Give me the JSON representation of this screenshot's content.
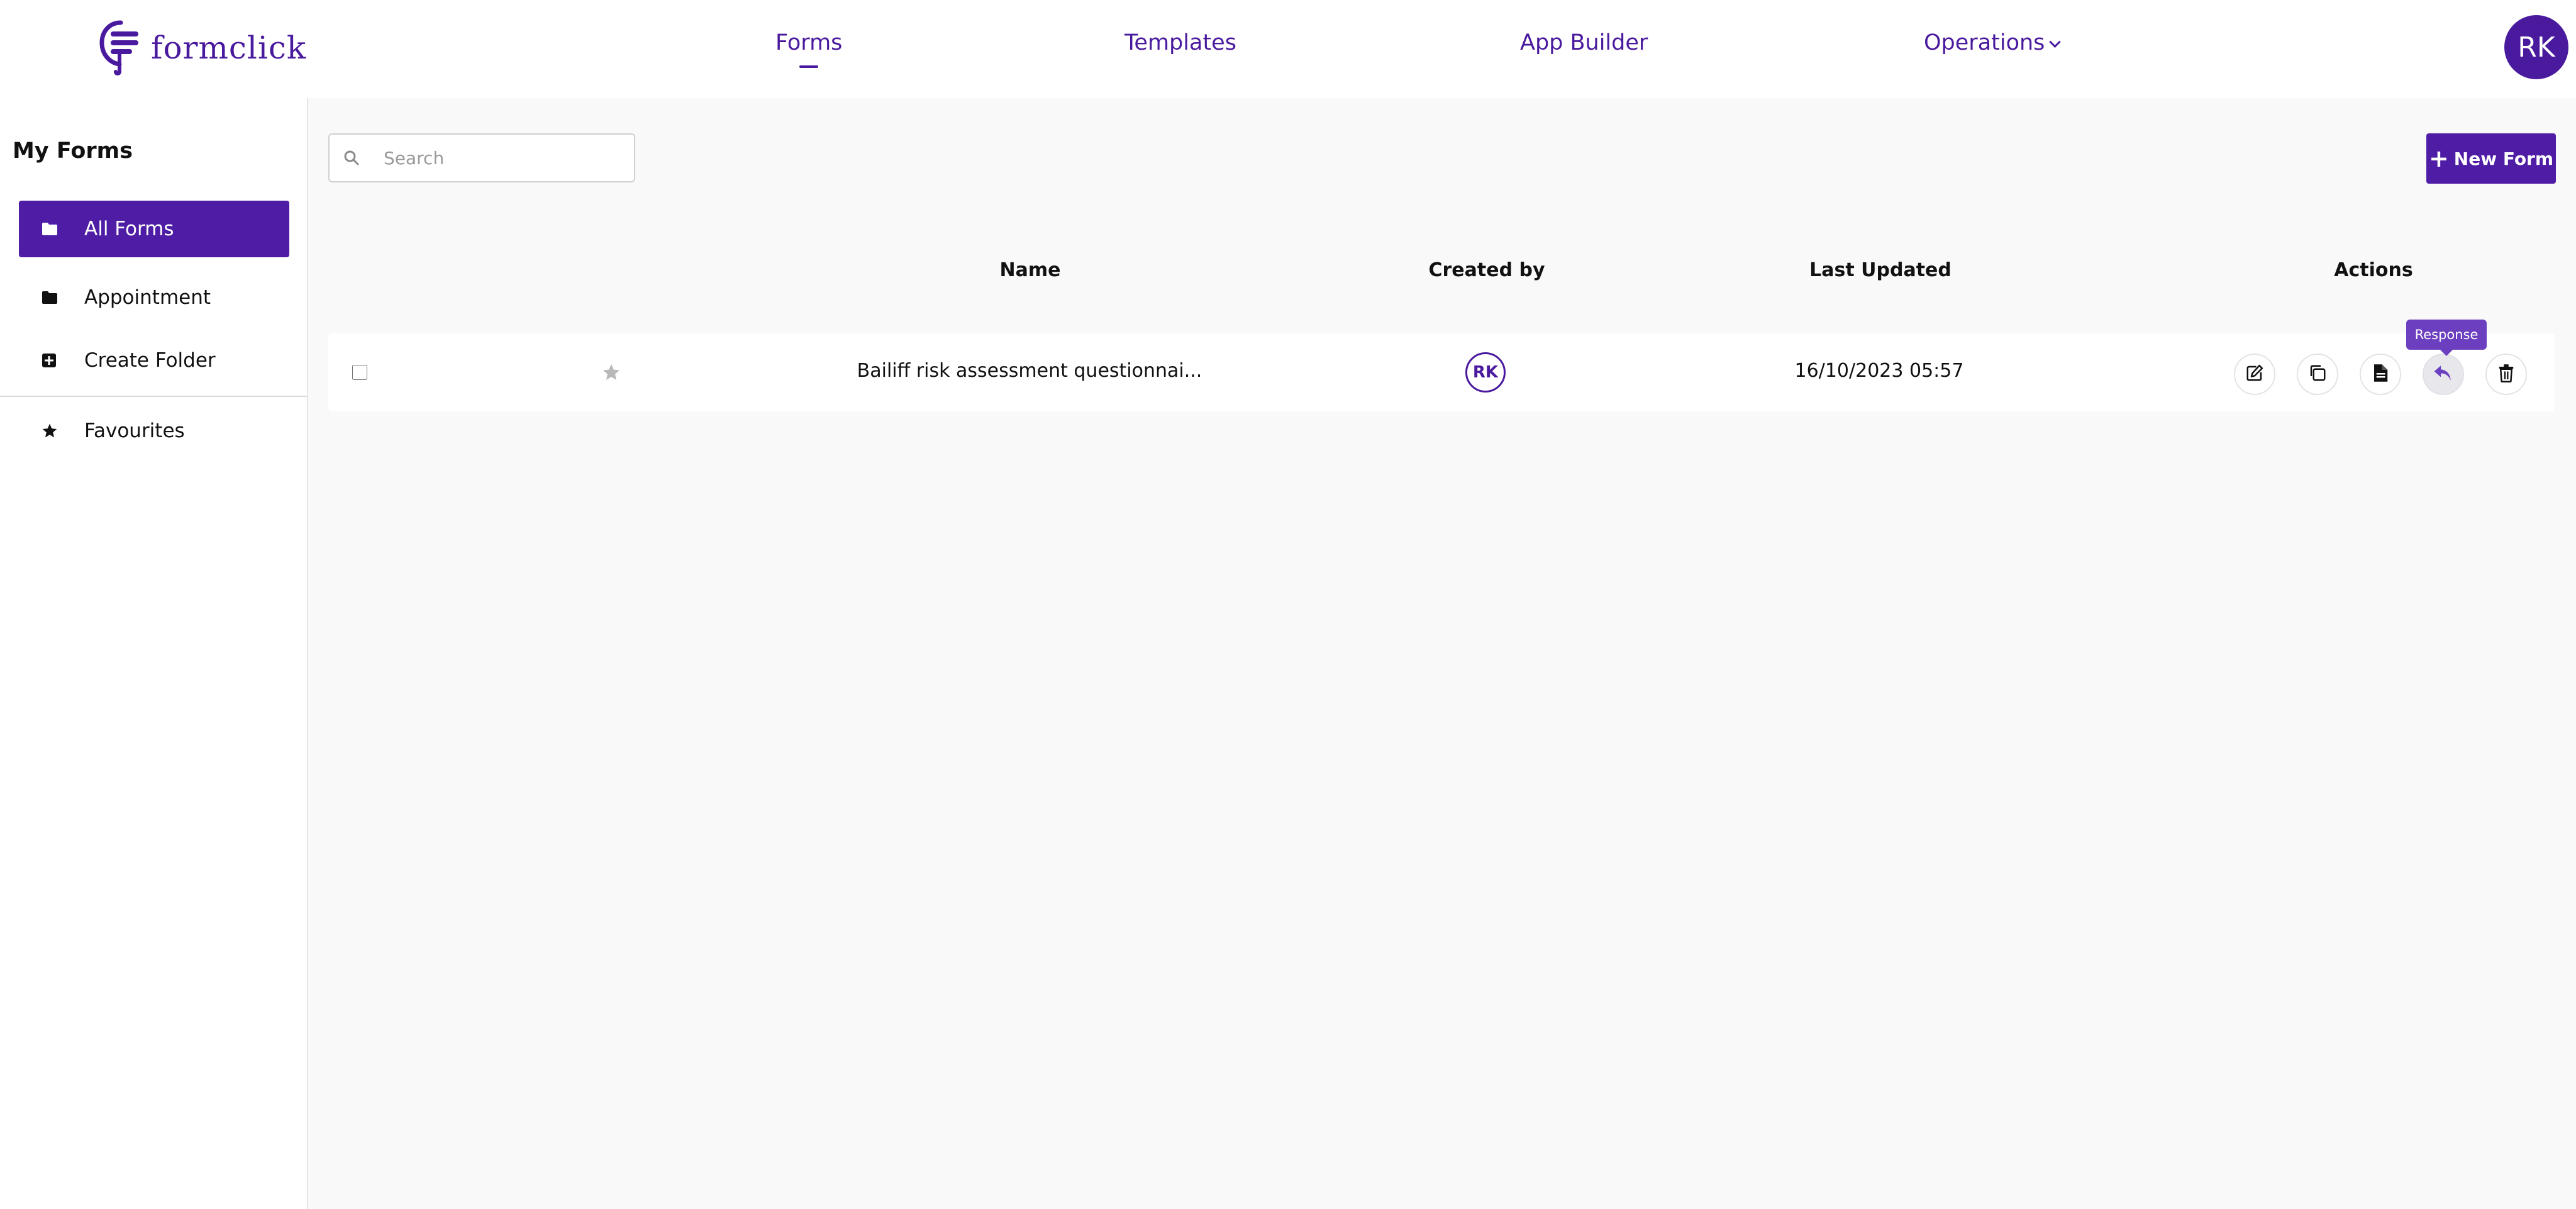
{
  "app": {
    "logo_text": "formclick",
    "brand_color": "#4a1a9e"
  },
  "nav": {
    "items": [
      {
        "label": "Forms",
        "active": true
      },
      {
        "label": "Templates"
      },
      {
        "label": "App Builder"
      },
      {
        "label": "Operations",
        "has_dropdown": true
      }
    ],
    "user_initials": "RK"
  },
  "sidebar": {
    "title": "My Forms",
    "items": [
      {
        "label": "All Forms",
        "icon": "folder-icon",
        "active": true
      },
      {
        "label": "Appointment",
        "icon": "folder-icon"
      },
      {
        "label": "Create Folder",
        "icon": "plus-square-icon"
      },
      {
        "label": "Favourites",
        "icon": "star-icon"
      }
    ]
  },
  "search": {
    "placeholder": "Search",
    "value": ""
  },
  "toolbar": {
    "new_form_label": "New Form"
  },
  "table": {
    "headers": {
      "name": "Name",
      "created_by": "Created by",
      "last_updated": "Last Updated",
      "actions": "Actions"
    },
    "rows": [
      {
        "name": "Bailiff risk assessment questionnai...",
        "created_by": "RK",
        "last_updated": "16/10/2023 05:57",
        "favourite": false,
        "checked": false
      }
    ],
    "action_icons": [
      "edit-icon",
      "copy-icon",
      "document-icon",
      "reply-icon",
      "trash-icon"
    ]
  },
  "tooltip": {
    "label": "Response",
    "color": "#6b3fc0"
  }
}
